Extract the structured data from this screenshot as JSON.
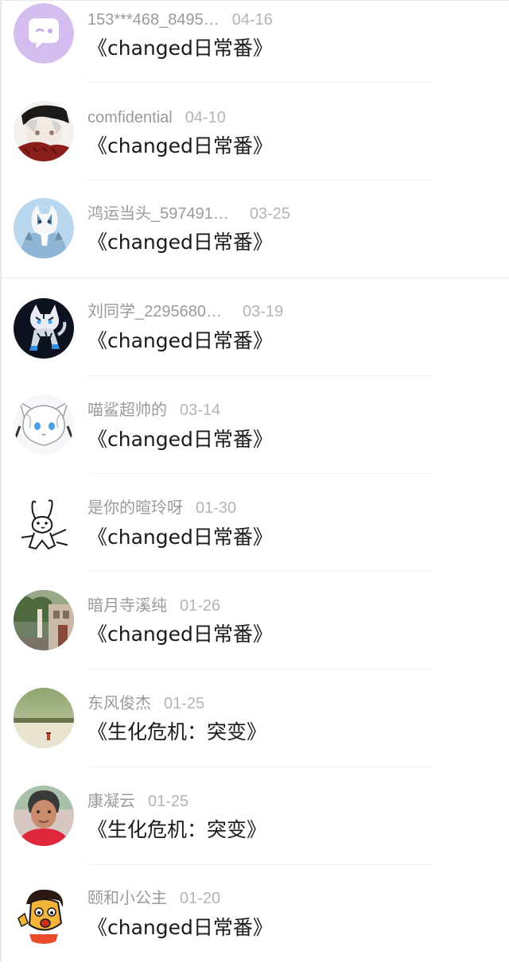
{
  "items": [
    {
      "name": "153***468_8495…",
      "date": "04-16",
      "title": "《changed日常番》",
      "avatar": "chat-bubble-avatar"
    },
    {
      "name": "comfidential",
      "date": "04-10",
      "title": "《changed日常番》",
      "avatar": "anime-character-avatar"
    },
    {
      "name": "鸿运当头_597491…",
      "date": "03-25",
      "title": "《changed日常番》",
      "avatar": "wolf-character-avatar"
    },
    {
      "name": "刘同学_2295680…",
      "date": "03-19",
      "title": "《changed日常番》",
      "avatar": "tiger-character-avatar"
    },
    {
      "name": "喵鲨超帅的",
      "date": "03-14",
      "title": "《changed日常番》",
      "avatar": "white-furry-avatar"
    },
    {
      "name": "是你的暄玲呀",
      "date": "01-30",
      "title": "《changed日常番》",
      "avatar": "rabbit-sketch-avatar"
    },
    {
      "name": "暗月寺溪纯",
      "date": "01-26",
      "title": "《changed日常番》",
      "avatar": "street-photo-avatar"
    },
    {
      "name": "东风俊杰",
      "date": "01-25",
      "title": "《生化危机：突变》",
      "avatar": "landscape-photo-avatar"
    },
    {
      "name": "康凝云",
      "date": "01-25",
      "title": "《生化危机：突变》",
      "avatar": "person-photo-avatar"
    },
    {
      "name": "颐和小公主",
      "date": "01-20",
      "title": "《changed日常番》",
      "avatar": "cartoon-face-avatar"
    }
  ]
}
